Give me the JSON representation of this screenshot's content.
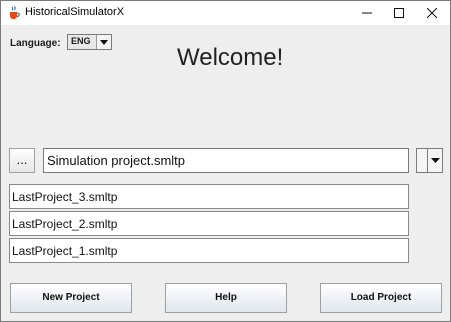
{
  "window": {
    "title": "HistoricalSimulatorX"
  },
  "language": {
    "label": "Language:",
    "selected": "ENG"
  },
  "welcome": {
    "heading": "Welcome!"
  },
  "project_selector": {
    "browse_label": "...",
    "current_value": "Simulation project.smltp"
  },
  "recent_projects": [
    "LastProject_3.smltp",
    "LastProject_2.smltp",
    "LastProject_1.smltp"
  ],
  "actions": {
    "new_project": "New Project",
    "help": "Help",
    "load_project": "Load Project"
  },
  "icons": {
    "app": "java-cup-icon",
    "minimize": "minimize-icon",
    "maximize": "maximize-icon",
    "close": "close-icon",
    "dropdown": "chevron-down-icon"
  },
  "colors": {
    "window_bg": "#eeeeee",
    "titlebar_bg": "#ffffff",
    "button_gradient_bottom": "#dfe6ee",
    "icon_blue": "#1f5f9e"
  }
}
